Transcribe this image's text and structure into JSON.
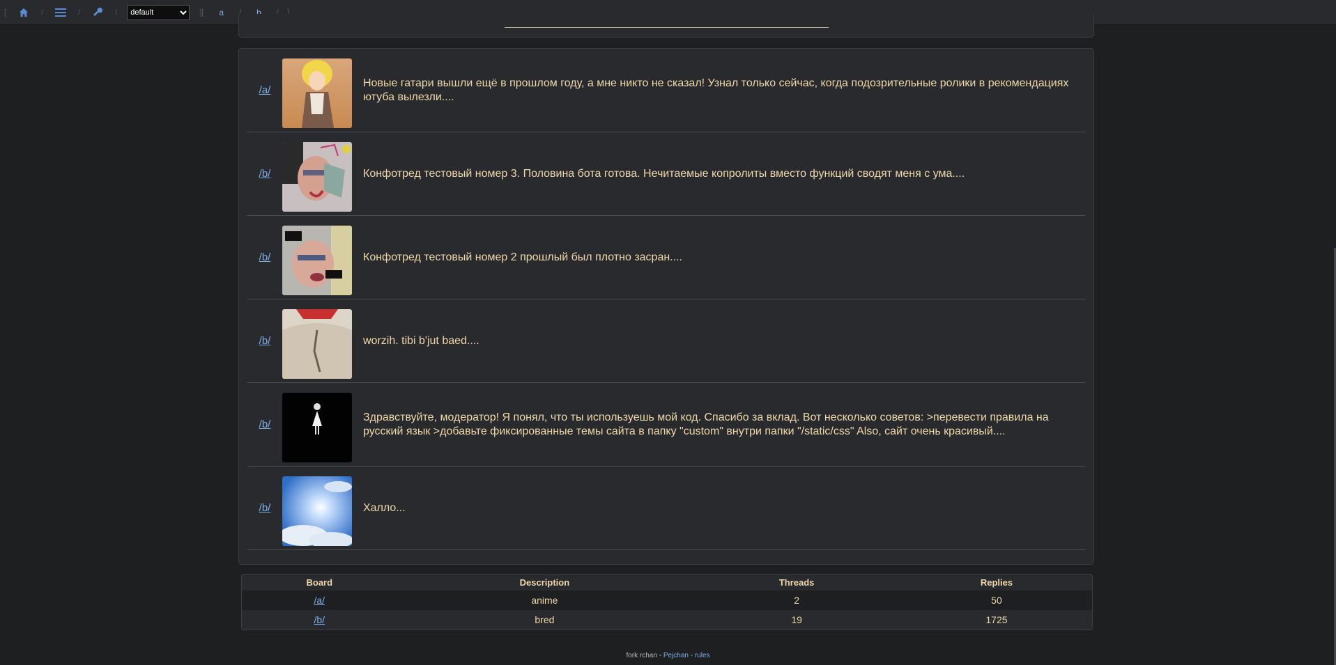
{
  "navbar": {
    "theme_select": {
      "selected": "default",
      "options": [
        "default"
      ]
    },
    "boards": [
      {
        "label": "a"
      },
      {
        "label": "b"
      }
    ],
    "icons": [
      "home-icon",
      "list-icon",
      "key-icon"
    ]
  },
  "posts": [
    {
      "board": "/a/",
      "text": "Новые гатари вышли ещё в прошлом году, а мне никто не сказал! Узнал только сейчас, когда подозрительные ролики в рекомендациях ютуба вылезли...."
    },
    {
      "board": "/b/",
      "text": "Конфотред тестовый номер 3. Половина бота готова. Нечитаемые копролиты вместо функций сводят меня с ума...."
    },
    {
      "board": "/b/",
      "text": "Конфотред тестовый номер 2 прошлый был плотно засран...."
    },
    {
      "board": "/b/",
      "text": "worzih. tibi b'jut baed...."
    },
    {
      "board": "/b/",
      "text": "Здравствуйте, модератор! Я понял, что ты используешь мой код. Спасибо за вклад. Вот несколько советов: >перевести правила на русский язык >добавьте фиксированные темы сайта в папку \"custom\" внутри папки \"/static/css\" Also, сайт очень красивый...."
    },
    {
      "board": "/b/",
      "text": "Халло..."
    }
  ],
  "boards_table": {
    "headers": [
      "Board",
      "Description",
      "Threads",
      "Replies"
    ],
    "rows": [
      {
        "board": "/a/",
        "description": "anime",
        "threads": "2",
        "replies": "50"
      },
      {
        "board": "/b/",
        "description": "bred",
        "threads": "19",
        "replies": "1725"
      }
    ]
  },
  "footer": {
    "prefix": "fork rchan - ",
    "link1": "Pejchan",
    "sep": " - ",
    "link2": "rules"
  },
  "colors": {
    "background": "#1d1f21",
    "panel": "#282a2e",
    "text": "#f0d8a8",
    "link": "#7fb0ea"
  }
}
